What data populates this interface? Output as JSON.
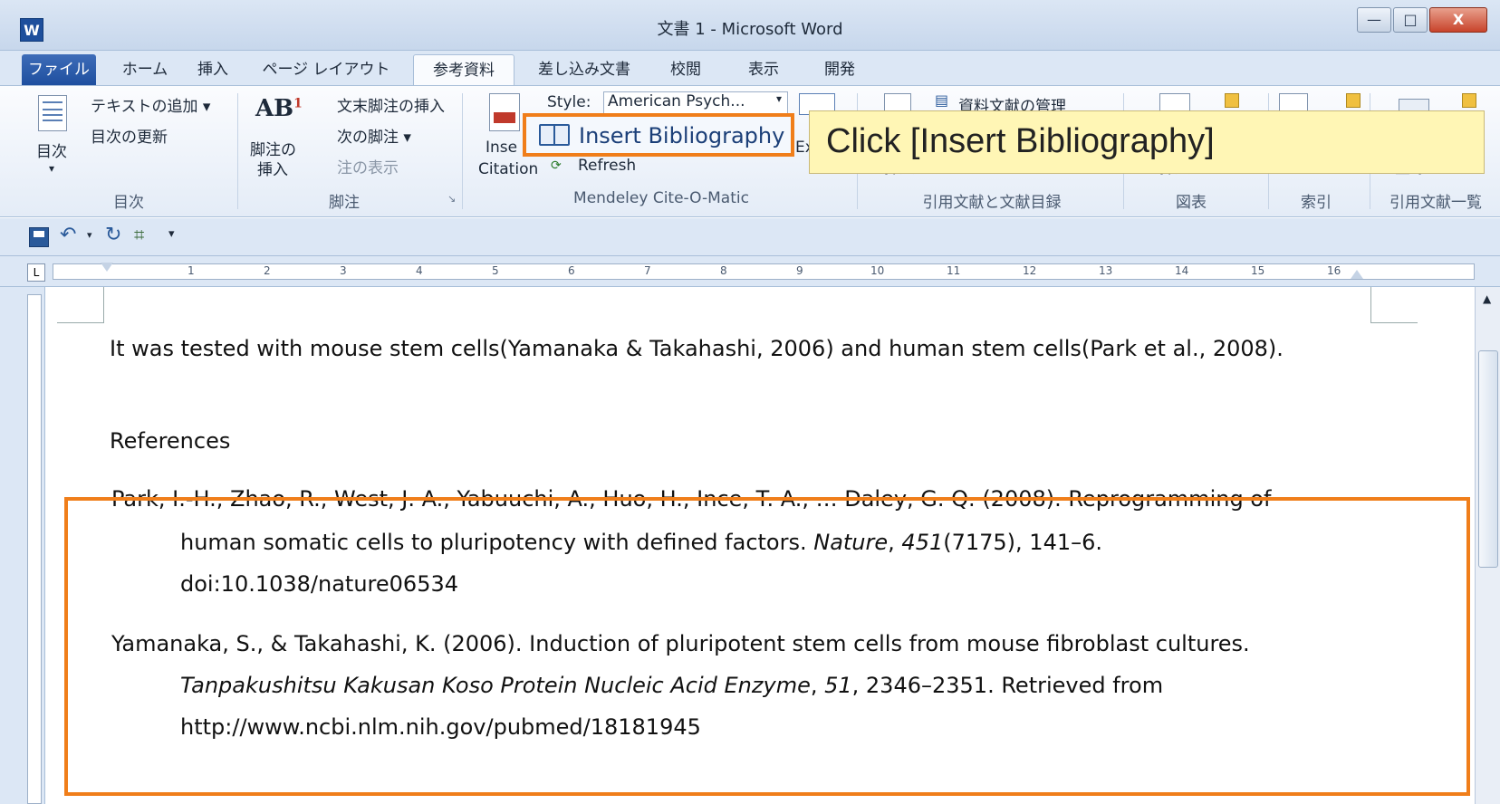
{
  "window": {
    "title": "文書 1 - Microsoft Word",
    "min": "—",
    "max": "□",
    "close": "X"
  },
  "tabs": [
    "ファイル",
    "ホーム",
    "挿入",
    "ページ レイアウト",
    "参考資料",
    "差し込み文書",
    "校閲",
    "表示",
    "開発"
  ],
  "ribbon": {
    "toc": {
      "big_label": "目次",
      "add_text": "テキストの追加 ▾",
      "update_toc": "目次の更新",
      "group": "目次"
    },
    "footnotes": {
      "insert_footnote_l1": "脚注の",
      "insert_footnote_l2": "挿入",
      "insert_endnote": "文末脚注の挿入",
      "next_footnote": "次の脚注 ▾",
      "show_notes": "注の表示",
      "group": "脚注"
    },
    "mendeley": {
      "style_label": "Style:",
      "style_value": "American Psych...",
      "insert_bibliography": "Insert Bibliography",
      "insert_citation_l1": "Inse",
      "insert_citation_l2": "Citation",
      "refresh": "Refresh",
      "export_partial": "Ex",
      "group": "Mendeley Cite-O-Matic"
    },
    "citations": {
      "manage_sources": "資料文献の管理",
      "insert_partial": "挿入",
      "group": "引用文献と文献目録"
    },
    "captions": {
      "insert_partial": "挿入",
      "group": "図表"
    },
    "index": {
      "group": "索引"
    },
    "toa": {
      "register_partial": "登録",
      "group": "引用文献一覧"
    }
  },
  "callout": "Click [Insert Bibliography]",
  "ruler": {
    "numbers": [
      "1",
      "2",
      "3",
      "4",
      "5",
      "6",
      "7",
      "8",
      "9",
      "10",
      "11",
      "12",
      "13",
      "14",
      "15",
      "16"
    ]
  },
  "document": {
    "sentence": "It was tested with mouse stem cells(Yamanaka & Takahashi, 2006) and human stem cells(Park et al., 2008).",
    "heading": "References",
    "ref1": {
      "line1": "Park, I.-H., Zhao, R., West, J. A., Yabuuchi, A., Huo, H., Ince, T. A., … Daley, G. Q. (2008). Reprogramming of",
      "line2_pre": "human somatic cells to pluripotency with defined factors. ",
      "journal": "Nature",
      "sep": ", ",
      "volume": "451",
      "line2_post": "(7175), 141–6.",
      "line3": "doi:10.1038/nature06534"
    },
    "ref2": {
      "line1": "Yamanaka, S., & Takahashi, K. (2006). Induction of pluripotent stem cells from mouse fibroblast cultures.",
      "journal": "Tanpakushitsu Kakusan Koso Protein Nucleic Acid Enzyme",
      "sep": ", ",
      "volume": "51",
      "line2_post": ", 2346–2351. Retrieved from",
      "line3": "http://www.ncbi.nlm.nih.gov/pubmed/18181945"
    }
  }
}
